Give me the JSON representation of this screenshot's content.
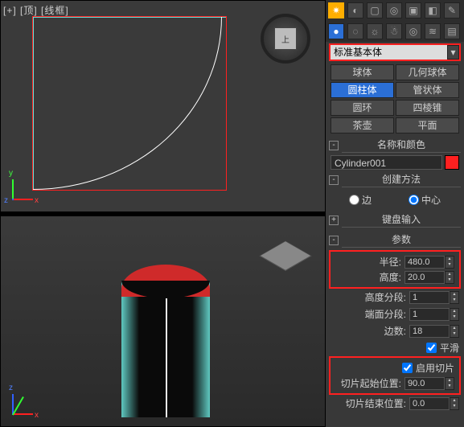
{
  "viewport": {
    "top_label": "[+] [顶] [线框]",
    "viewcube_face": "上",
    "axis": {
      "x": "x",
      "y": "y",
      "z": "z"
    }
  },
  "toolbar_top_icons": [
    "✷",
    "◐",
    "▢",
    "◎",
    "▣",
    "◧",
    "✎"
  ],
  "toolbar_sub_icons": [
    "●",
    "◌",
    "☼",
    "☃",
    "◎",
    "≋",
    "▤"
  ],
  "dropdown": {
    "label": "标准基本体",
    "arrow": "▾"
  },
  "shape_buttons": [
    {
      "label": "球体"
    },
    {
      "label": "几何球体"
    },
    {
      "label": "圆柱体",
      "selected": true
    },
    {
      "label": "管状体"
    },
    {
      "label": "圆环"
    },
    {
      "label": "四棱锥"
    },
    {
      "label": "茶壶"
    },
    {
      "label": "平面"
    }
  ],
  "rollouts": {
    "name_color": {
      "title": "名称和颜色",
      "plusminus": "-"
    },
    "create_method": {
      "title": "创建方法",
      "plusminus": "-"
    },
    "keyboard": {
      "title": "键盘输入",
      "plusminus": "+"
    },
    "params": {
      "title": "参数",
      "plusminus": "-"
    }
  },
  "object": {
    "name": "Cylinder001"
  },
  "create_method": {
    "edge": {
      "label": "边",
      "checked": false
    },
    "center": {
      "label": "中心",
      "checked": true
    }
  },
  "params": {
    "radius": {
      "label": "半径:",
      "value": "480.0"
    },
    "height": {
      "label": "高度:",
      "value": "20.0"
    },
    "height_segs": {
      "label": "高度分段:",
      "value": "1"
    },
    "cap_segs": {
      "label": "端面分段:",
      "value": "1"
    },
    "sides": {
      "label": "边数:",
      "value": "18"
    },
    "smooth": {
      "label": "平滑",
      "checked": true
    },
    "slice_on": {
      "label": "启用切片",
      "checked": true
    },
    "slice_from": {
      "label": "切片起始位置:",
      "value": "90.0"
    },
    "slice_to": {
      "label": "切片结束位置:",
      "value": "0.0"
    }
  }
}
